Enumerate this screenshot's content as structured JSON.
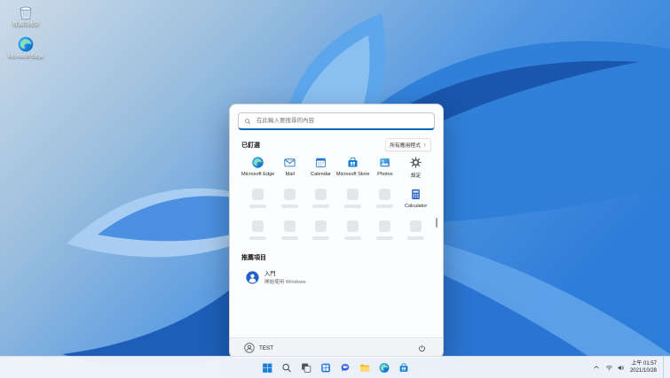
{
  "desktop": {
    "icons": [
      {
        "label": "資源回收筒"
      },
      {
        "label": "Microsoft Edge"
      }
    ]
  },
  "start_menu": {
    "search_placeholder": "在此輸入要搜尋的內容",
    "pinned_title": "已釘選",
    "all_apps_label": "所有應用程式",
    "apps": [
      {
        "label": "Microsoft Edge"
      },
      {
        "label": "Mail"
      },
      {
        "label": "Calendar"
      },
      {
        "label": "Microsoft Store"
      },
      {
        "label": "Photos"
      },
      {
        "label": "設定"
      }
    ],
    "calculator_label": "Calculator",
    "recommended_title": "推薦項目",
    "recommended": [
      {
        "title": "入門",
        "subtitle": "開始使用 Windows"
      }
    ],
    "user_name": "TEST"
  },
  "taskbar": {
    "buttons": [
      "start",
      "search",
      "task-view",
      "widgets",
      "chat",
      "file-explorer",
      "edge",
      "store"
    ],
    "tray_icons": [
      "chevron-up",
      "network",
      "volume"
    ],
    "tray": {
      "time": "上午 01:57",
      "date": "2021/10/28"
    }
  },
  "colors": {
    "accent": "#0067c0",
    "taskbar_bg": "#f2f6fa",
    "menu_bg": "#fcfdfe"
  }
}
